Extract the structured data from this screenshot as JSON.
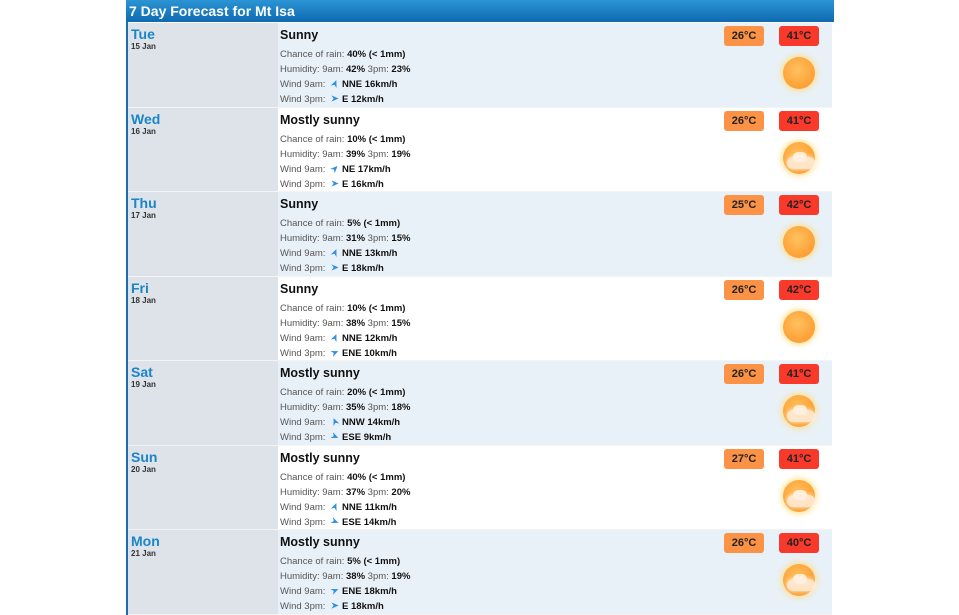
{
  "header": {
    "title": "7 Day Forecast for Mt Isa"
  },
  "labels": {
    "chance_of_rain": "Chance of rain: ",
    "humidity": "Humidity:  9am: ",
    "humidity_3pm": "  3pm: ",
    "wind_9am": "Wind 9am: ",
    "wind_3pm": "Wind 3pm: "
  },
  "colors": {
    "accent": "#1a86c8",
    "min_temp_bg": "#fb9245",
    "max_temp_bg": "#f93a2a"
  },
  "days": [
    {
      "day": "Tue",
      "date": "15 Jan",
      "summary": "Sunny",
      "icon": "sunny-icon",
      "rain": "40% (< 1mm)",
      "hum_9am": "42%",
      "hum_3pm": "23%",
      "wind_9am": "NNE 16km/h",
      "wind_9am_dir": "NNE",
      "wind_3pm": "E 12km/h",
      "wind_3pm_dir": "E",
      "min": "26°C",
      "max": "41°C"
    },
    {
      "day": "Wed",
      "date": "16 Jan",
      "summary": "Mostly sunny",
      "icon": "mostly-sunny-icon",
      "rain": "10% (< 1mm)",
      "hum_9am": "39%",
      "hum_3pm": "19%",
      "wind_9am": "NE 17km/h",
      "wind_9am_dir": "NE",
      "wind_3pm": "E 16km/h",
      "wind_3pm_dir": "E",
      "min": "26°C",
      "max": "41°C"
    },
    {
      "day": "Thu",
      "date": "17 Jan",
      "summary": "Sunny",
      "icon": "sunny-icon",
      "rain": "5% (< 1mm)",
      "hum_9am": "31%",
      "hum_3pm": "15%",
      "wind_9am": "NNE 13km/h",
      "wind_9am_dir": "NNE",
      "wind_3pm": "E 18km/h",
      "wind_3pm_dir": "E",
      "min": "25°C",
      "max": "42°C"
    },
    {
      "day": "Fri",
      "date": "18 Jan",
      "summary": "Sunny",
      "icon": "sunny-icon",
      "rain": "10% (< 1mm)",
      "hum_9am": "38%",
      "hum_3pm": "15%",
      "wind_9am": "NNE 12km/h",
      "wind_9am_dir": "NNE",
      "wind_3pm": "ENE 10km/h",
      "wind_3pm_dir": "ENE",
      "min": "26°C",
      "max": "42°C"
    },
    {
      "day": "Sat",
      "date": "19 Jan",
      "summary": "Mostly sunny",
      "icon": "mostly-sunny-icon",
      "rain": "20% (< 1mm)",
      "hum_9am": "35%",
      "hum_3pm": "18%",
      "wind_9am": "NNW 14km/h",
      "wind_9am_dir": "NNW",
      "wind_3pm": "ESE 9km/h",
      "wind_3pm_dir": "ESE",
      "min": "26°C",
      "max": "41°C"
    },
    {
      "day": "Sun",
      "date": "20 Jan",
      "summary": "Mostly sunny",
      "icon": "mostly-sunny-icon",
      "rain": "40% (< 1mm)",
      "hum_9am": "37%",
      "hum_3pm": "20%",
      "wind_9am": "NNE 11km/h",
      "wind_9am_dir": "NNE",
      "wind_3pm": "ESE 14km/h",
      "wind_3pm_dir": "ESE",
      "min": "27°C",
      "max": "41°C"
    },
    {
      "day": "Mon",
      "date": "21 Jan",
      "summary": "Mostly sunny",
      "icon": "mostly-sunny-icon",
      "rain": "5% (< 1mm)",
      "hum_9am": "38%",
      "hum_3pm": "19%",
      "wind_9am": "ENE 18km/h",
      "wind_9am_dir": "ENE",
      "wind_3pm": "E 18km/h",
      "wind_3pm_dir": "E",
      "min": "26°C",
      "max": "40°C"
    }
  ]
}
